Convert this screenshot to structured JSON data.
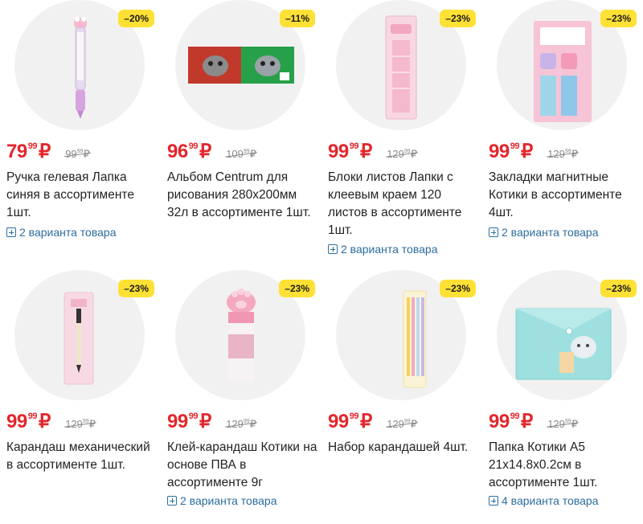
{
  "currency": "₽",
  "products": [
    {
      "badge": "–20%",
      "price_int": "79",
      "price_frac": "99",
      "old_int": "99",
      "old_frac": "99",
      "title": "Ручка гелевая Лапка синяя в ассортименте 1шт.",
      "variants": "2 варианта товара",
      "icon": "pen-image"
    },
    {
      "badge": "–11%",
      "price_int": "96",
      "price_frac": "99",
      "old_int": "109",
      "old_frac": "99",
      "title": "Альбом Centrum для рисования 280х200мм 32л в ассортименте 1шт.",
      "variants": "",
      "icon": "album-image"
    },
    {
      "badge": "–23%",
      "price_int": "99",
      "price_frac": "99",
      "old_int": "129",
      "old_frac": "99",
      "title": "Блоки листов Лапки с клеевым краем 120 листов в ассортименте 1шт.",
      "variants": "2 варианта товара",
      "icon": "sticky-notes-image"
    },
    {
      "badge": "–23%",
      "price_int": "99",
      "price_frac": "99",
      "old_int": "129",
      "old_frac": "99",
      "title": "Закладки магнитные Котики в ассортименте 4шт.",
      "variants": "2 варианта товара",
      "icon": "bookmarks-image"
    },
    {
      "badge": "–23%",
      "price_int": "99",
      "price_frac": "99",
      "old_int": "129",
      "old_frac": "99",
      "title": "Карандаш механический в ассортименте 1шт.",
      "variants": "",
      "icon": "mechanical-pencil-image"
    },
    {
      "badge": "–23%",
      "price_int": "99",
      "price_frac": "99",
      "old_int": "129",
      "old_frac": "99",
      "title": "Клей-карандаш Котики на основе ПВА в ассортименте 9г",
      "variants": "2 варианта товара",
      "icon": "glue-stick-image"
    },
    {
      "badge": "–23%",
      "price_int": "99",
      "price_frac": "99",
      "old_int": "129",
      "old_frac": "99",
      "title": "Набор карандашей 4шт.",
      "variants": "",
      "icon": "pencil-set-image"
    },
    {
      "badge": "–23%",
      "price_int": "99",
      "price_frac": "99",
      "old_int": "129",
      "old_frac": "99",
      "title": "Папка Котики А5 21х14.8х0.2см в ассортименте 1шт.",
      "variants": "4 варианта товара",
      "icon": "folder-image"
    }
  ]
}
